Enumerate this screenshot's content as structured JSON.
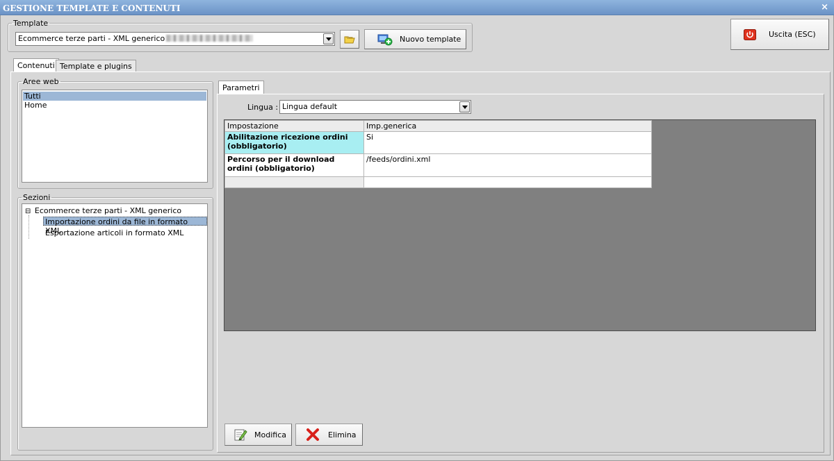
{
  "window": {
    "title": "GESTIONE TEMPLATE E CONTENUTI",
    "close_glyph": "×"
  },
  "template": {
    "legend": "Template",
    "selected": "Ecommerce terze parti - XML generico",
    "new_button": "Nuovo template"
  },
  "exit_button": "Uscita (ESC)",
  "tabs": [
    {
      "label": "Contenuti",
      "active": true
    },
    {
      "label": "Template e plugins",
      "active": false
    }
  ],
  "aree_web": {
    "legend": "Aree web",
    "items": [
      {
        "label": "Tutti",
        "selected": true
      },
      {
        "label": "Home",
        "selected": false
      }
    ]
  },
  "sezioni": {
    "legend": "Sezioni",
    "tree_toggle": "⊟",
    "root": "Ecommerce terze parti - XML generico",
    "children": [
      {
        "label": "Importazione ordini da file in formato XML",
        "selected": true
      },
      {
        "label": "Esportazione articoli in formato XML",
        "selected": false
      }
    ]
  },
  "parametri": {
    "tab": "Parametri",
    "lingua_label": "Lingua :",
    "lingua_value": "Lingua default",
    "columns": [
      "Impostazione",
      "Imp.generica"
    ],
    "rows": [
      {
        "name": "Abilitazione ricezione ordini (obbligatorio)",
        "value": "Si",
        "highlight": true
      },
      {
        "name": "Percorso per il download ordini (obbligatorio)",
        "value": "/feeds/ordini.xml",
        "highlight": false
      }
    ]
  },
  "actions": {
    "modifica": "Modifica",
    "elimina": "Elimina"
  },
  "colors": {
    "title_bar": "#7aa0d0",
    "selection": "#9cb7d6",
    "highlight_cell": "#a8eef2",
    "grid_bg": "#808080"
  },
  "icons": [
    "folder-icon",
    "new-template-icon",
    "power-icon",
    "edit-icon",
    "delete-x-icon"
  ]
}
